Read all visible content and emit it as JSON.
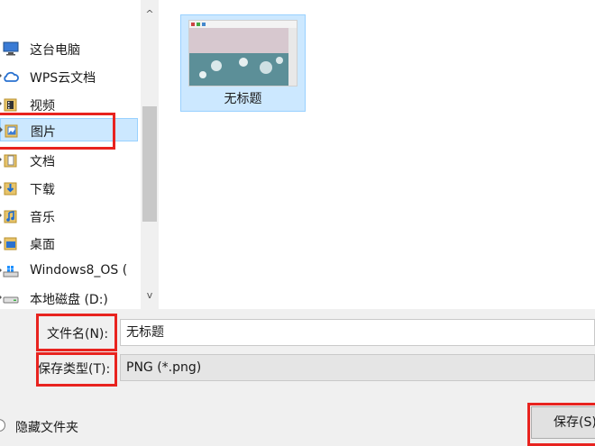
{
  "nav": {
    "items": [
      {
        "label": "这台电脑",
        "icon": "computer-icon"
      },
      {
        "label": "WPS云文档",
        "icon": "cloud-icon"
      },
      {
        "label": "视频",
        "icon": "video-folder-icon"
      },
      {
        "label": "图片",
        "icon": "pictures-folder-icon"
      },
      {
        "label": "文档",
        "icon": "documents-folder-icon"
      },
      {
        "label": "下载",
        "icon": "downloads-folder-icon"
      },
      {
        "label": "音乐",
        "icon": "music-folder-icon"
      },
      {
        "label": "桌面",
        "icon": "desktop-folder-icon"
      },
      {
        "label": "Windows8_OS (",
        "icon": "os-drive-icon"
      },
      {
        "label": "本地磁盘 (D:)",
        "icon": "local-disk-icon"
      }
    ],
    "scroll_up": "^",
    "scroll_down": "v"
  },
  "content": {
    "files": [
      {
        "name": "无标题",
        "icon": "image-thumbnail"
      }
    ]
  },
  "form": {
    "filename_label": "文件名(N):",
    "filename_value": "无标题",
    "filetype_label": "保存类型(T):",
    "filetype_value": "PNG (*.png)"
  },
  "footer": {
    "hide_folders_label": "隐藏文件夹",
    "save_label": "保存(S)"
  },
  "colors": {
    "selection_bg": "#cce8ff",
    "selection_border": "#99d1ff",
    "highlight_red": "#e8231f"
  }
}
